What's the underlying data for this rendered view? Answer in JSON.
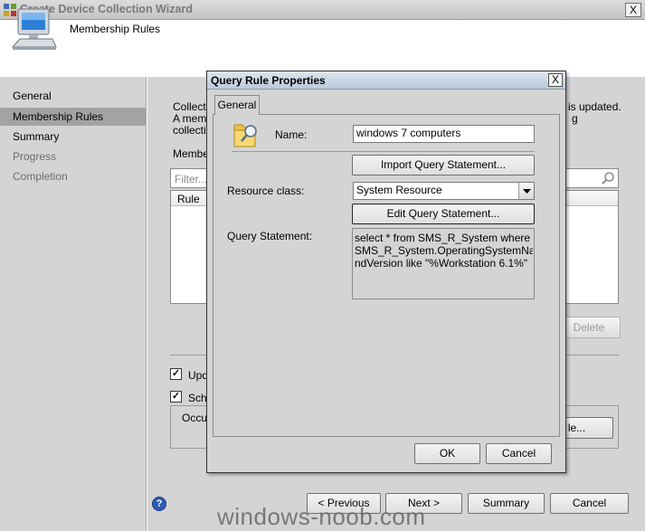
{
  "wizard": {
    "title": "Create Device Collection Wizard",
    "close": "X",
    "header_title": "Membership Rules",
    "nav": [
      "General",
      "Membership Rules",
      "Summary",
      "Progress",
      "Completion"
    ],
    "content": {
      "desc_line1": "Collectio",
      "desc_line1_right": "is updated.",
      "desc_line2": "A memb",
      "desc_line2_right": "g",
      "desc_line3": "collecti",
      "members_label": "Member",
      "filter_placeholder": "Filter...",
      "column_rule": "Rule",
      "delete_label": "Delete",
      "check1_label": "Upd",
      "check2_label": "Sch",
      "occurs_label": "Occu",
      "schedule_btn_label": "le..."
    },
    "buttons": {
      "previous": "< Previous",
      "next": "Next >",
      "summary": "Summary",
      "cancel": "Cancel"
    },
    "help_icon": "?"
  },
  "dialog": {
    "title": "Query Rule Properties",
    "close": "X",
    "tab": "General",
    "name_label": "Name:",
    "name_value": "windows 7 computers",
    "import_button": "Import Query Statement...",
    "resource_class_label": "Resource class:",
    "resource_class_value": "System Resource",
    "edit_button": "Edit Query Statement...",
    "query_label": "Query Statement:",
    "query_lines": [
      "select * from  SMS_R_System where",
      "SMS_R_System.OperatingSystemNamea",
      "ndVersion like \"%Workstation 6.1%\""
    ],
    "ok": "OK",
    "cancel": "Cancel"
  },
  "watermark": "windows-noob.com"
}
